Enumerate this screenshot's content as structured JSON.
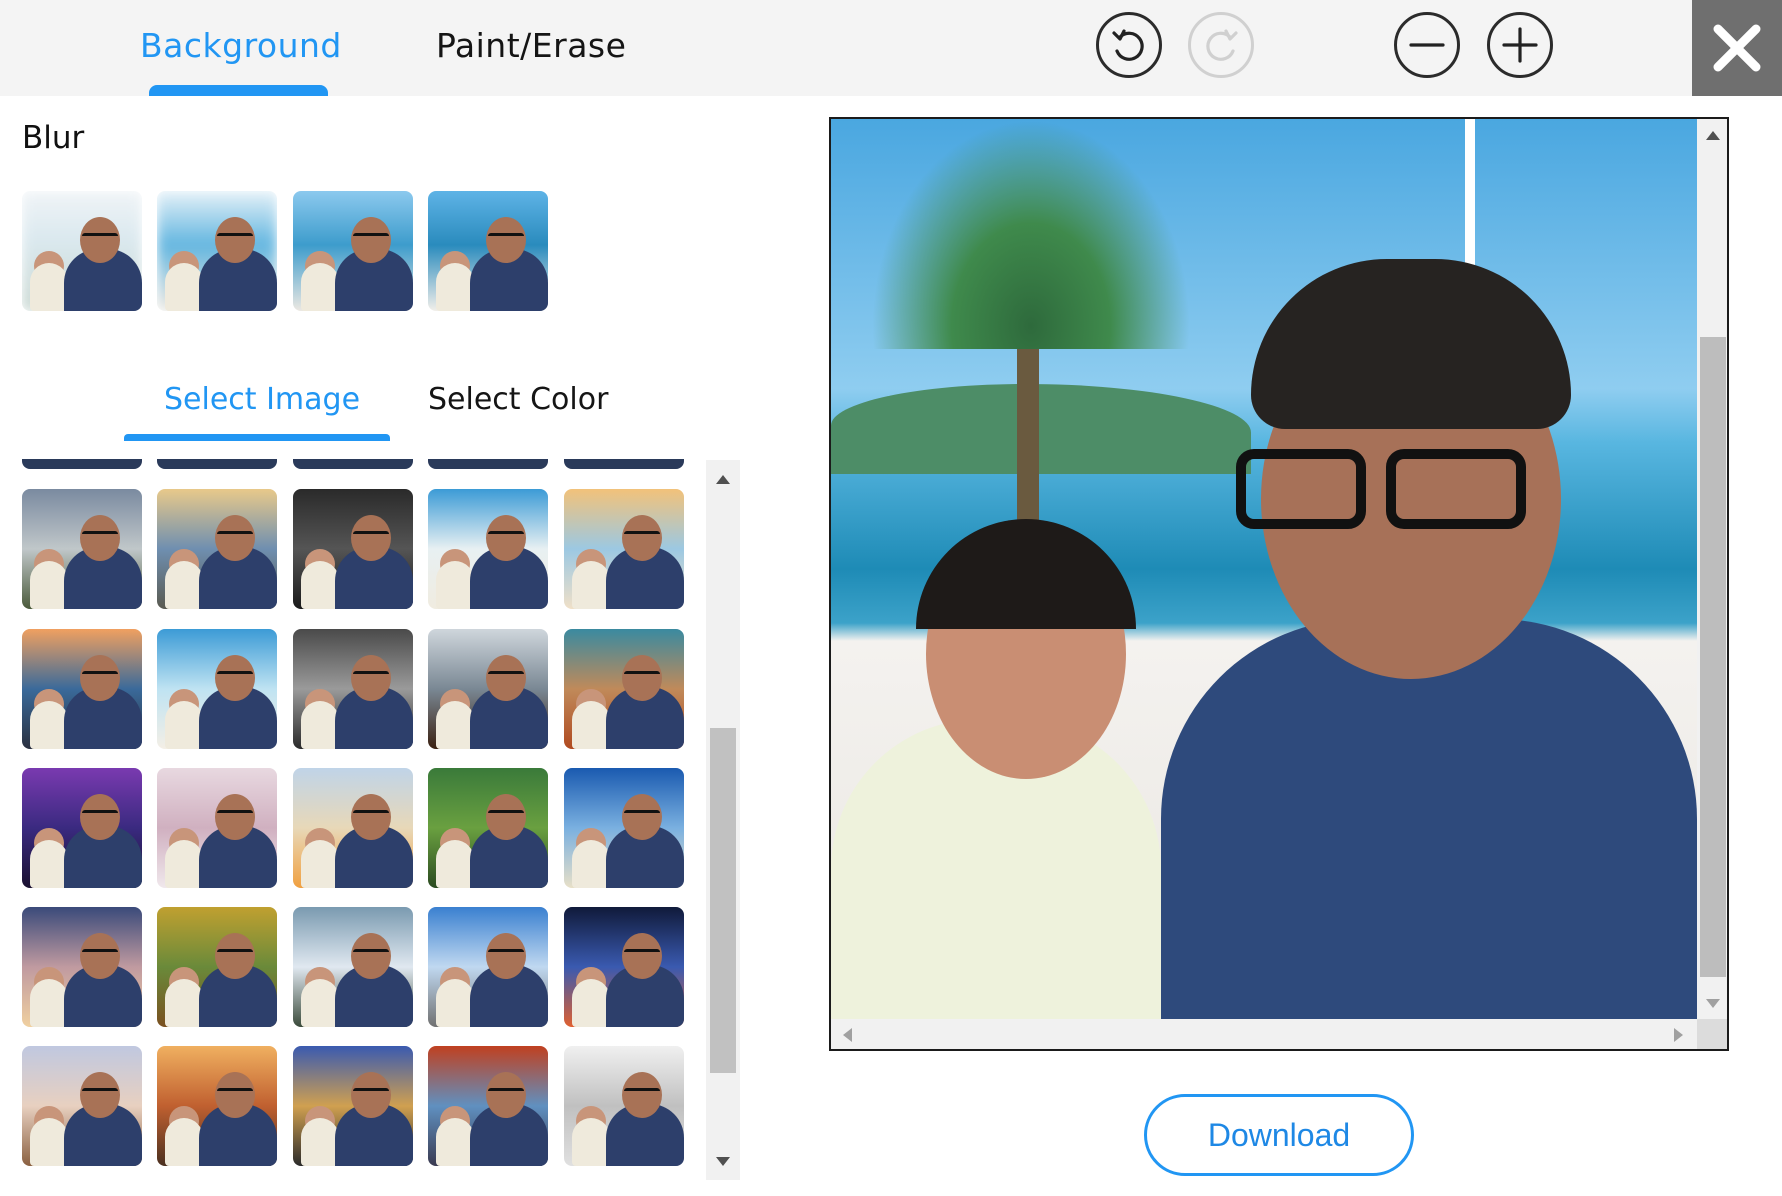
{
  "tabs": {
    "background_label": "Background",
    "paint_erase_label": "Paint/Erase",
    "active": "Background"
  },
  "toolbar": {
    "undo_icon": "undo-icon",
    "redo_icon": "redo-icon",
    "zoom_out_icon": "minus-icon",
    "zoom_in_icon": "plus-icon",
    "close_icon": "close-icon"
  },
  "blur": {
    "label": "Blur",
    "options": 4
  },
  "subtabs": {
    "select_image_label": "Select Image",
    "select_color_label": "Select Color",
    "active": "Select Image"
  },
  "actions": {
    "download_label": "Download"
  },
  "colors": {
    "accent": "#2196f3",
    "topbar_bg": "#f4f4f4",
    "close_bg": "#6f6f6f"
  }
}
